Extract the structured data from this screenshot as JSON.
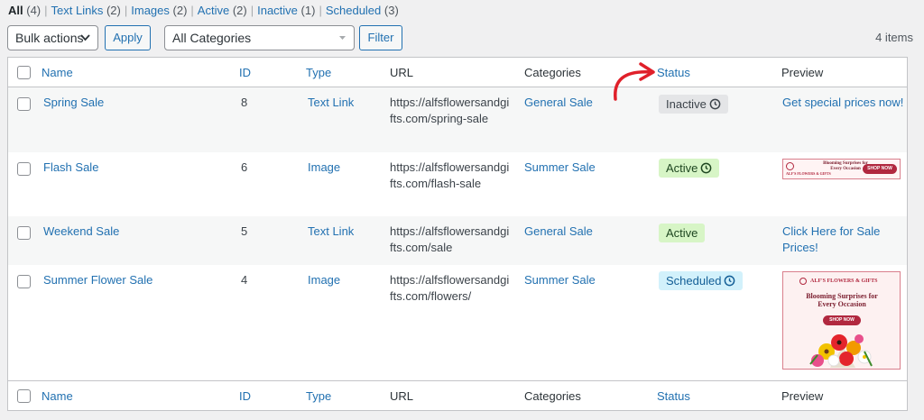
{
  "filters": [
    {
      "label": "All",
      "count": "(4)",
      "current": true
    },
    {
      "label": "Text Links",
      "count": "(2)"
    },
    {
      "label": "Images",
      "count": "(2)"
    },
    {
      "label": "Active",
      "count": "(2)"
    },
    {
      "label": "Inactive",
      "count": "(1)"
    },
    {
      "label": "Scheduled",
      "count": "(3)"
    }
  ],
  "toolbar": {
    "bulk_actions": "Bulk actions",
    "apply": "Apply",
    "category_select": "All Categories",
    "filter": "Filter",
    "items_count": "4 items"
  },
  "columns": {
    "name": "Name",
    "id": "ID",
    "type": "Type",
    "url": "URL",
    "categories": "Categories",
    "status": "Status",
    "preview": "Preview"
  },
  "rows": [
    {
      "name": "Spring Sale",
      "id": "8",
      "type": "Text Link",
      "url": "https://alfsflowersandgifts.com/spring-sale",
      "url_line1": "https://alfsflowersandgi",
      "url_line2": "fts.com/spring-sale",
      "category": "General Sale",
      "status": "Inactive",
      "preview_text": "Get special prices now!"
    },
    {
      "name": "Flash Sale",
      "id": "6",
      "type": "Image",
      "url": "https://alfsflowersandgifts.com/flash-sale",
      "url_line1": "https://alfsflowersandgi",
      "url_line2": "fts.com/flash-sale",
      "category": "Summer Sale",
      "status": "Active"
    },
    {
      "name": "Weekend Sale",
      "id": "5",
      "type": "Text Link",
      "url": "https://alfsflowersandgifts.com/sale",
      "url_line1": "https://alfsflowersandgi",
      "url_line2": "fts.com/sale",
      "category": "General Sale",
      "status": "Active",
      "preview_text_line1": "Click Here for Sale",
      "preview_text_line2": "Prices!"
    },
    {
      "name": "Summer Flower Sale",
      "id": "4",
      "type": "Image",
      "url": "https://alfsflowersandgifts.com/flowers/",
      "url_line1": "https://alfsflowersandgi",
      "url_line2": "fts.com/flowers/",
      "category": "Summer Sale",
      "status": "Scheduled"
    }
  ],
  "banner": {
    "brand": "ALF'S FLOWERS & GIFTS",
    "tagline_line1": "Blooming Surprises for",
    "tagline_line2": "Every Occasion",
    "cta": "SHOP NOW"
  },
  "colors": {
    "link": "#2271b1",
    "annotation_arrow": "#e0202a",
    "inactive_badge": "#e4e5e7",
    "active_badge": "#d7f5c6",
    "scheduled_badge": "#d2f1fb"
  }
}
